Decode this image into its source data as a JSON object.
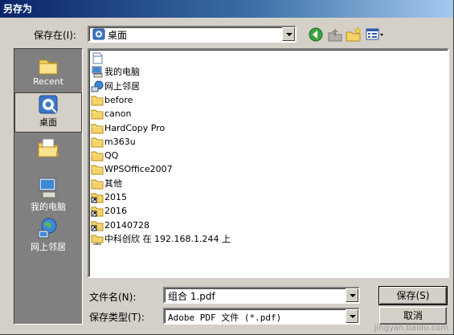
{
  "window": {
    "title": "另存为"
  },
  "location": {
    "label": "保存在(I):",
    "value": "桌面"
  },
  "toolbar": {
    "back_icon": "back-arrow-icon",
    "up_icon": "up-folder-icon",
    "new_folder_icon": "new-folder-icon",
    "views_icon": "views-menu-icon"
  },
  "places": [
    {
      "label": "Recent",
      "icon": "recent-icon"
    },
    {
      "label": "桌面",
      "icon": "desktop-icon",
      "selected": true
    },
    {
      "label": "",
      "icon": "my-documents-icon"
    },
    {
      "label": "我的电脑",
      "icon": "my-computer-icon"
    },
    {
      "label": "网上邻居",
      "icon": "network-places-icon"
    }
  ],
  "files": [
    {
      "name": "",
      "icon": "document-icon"
    },
    {
      "name": "我的电脑",
      "icon": "computer-icon"
    },
    {
      "name": "网上邻居",
      "icon": "network-icon"
    },
    {
      "name": "before",
      "icon": "folder-icon"
    },
    {
      "name": "canon",
      "icon": "folder-icon"
    },
    {
      "name": "HardCopy Pro",
      "icon": "folder-icon"
    },
    {
      "name": "m363u",
      "icon": "folder-icon"
    },
    {
      "name": "QQ",
      "icon": "folder-icon"
    },
    {
      "name": "WPSOffice2007",
      "icon": "folder-icon"
    },
    {
      "name": "其他",
      "icon": "folder-icon"
    },
    {
      "name": "2015",
      "icon": "folder-shortcut-icon"
    },
    {
      "name": "2016",
      "icon": "folder-shortcut-icon"
    },
    {
      "name": "20140728",
      "icon": "folder-shortcut-icon"
    },
    {
      "name": "中科创欣 在 192.168.1.244 上",
      "icon": "network-folder-icon"
    }
  ],
  "filename": {
    "label": "文件名(N):",
    "value": "组合 1.pdf"
  },
  "filetype": {
    "label": "保存类型(T):",
    "value": "Adobe PDF 文件 (*.pdf)"
  },
  "buttons": {
    "save": "保存(S)",
    "cancel": "取消"
  },
  "watermark": "jingyan.baidu.com"
}
